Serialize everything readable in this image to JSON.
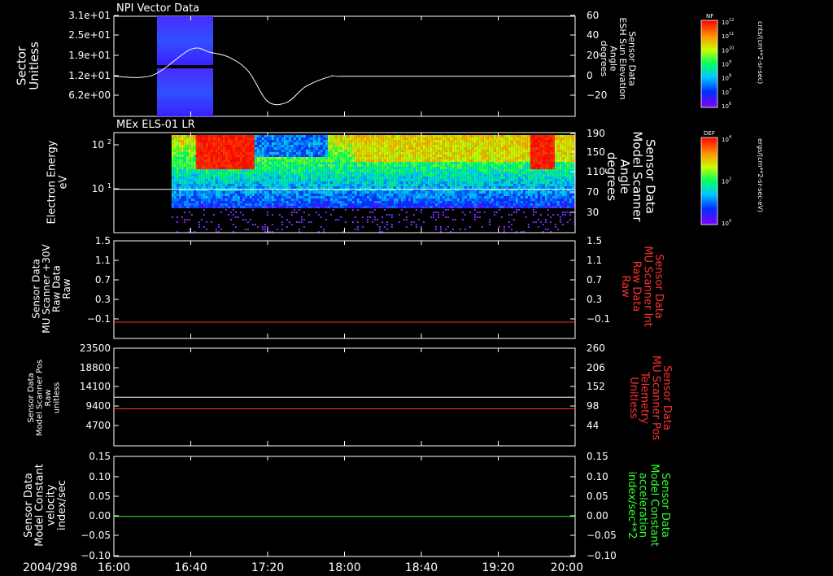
{
  "date_label": "2004/298",
  "time_ticks": [
    "16:00",
    "16:40",
    "17:20",
    "18:00",
    "18:40",
    "19:20",
    "20:00"
  ],
  "panels": [
    {
      "id": "npi",
      "title": "NPI Vector Data",
      "left_label": [
        "Sector",
        "Unitless"
      ],
      "left_ticks": [
        "3.1e+01",
        "2.5e+01",
        "1.9e+01",
        "1.2e+01",
        "6.2e+00"
      ],
      "right_label": [
        "Sensor Data",
        "ESH Sun Elevation",
        "Angle",
        "degrees"
      ],
      "right_ticks": [
        "60",
        "40",
        "20",
        "0",
        "−20"
      ],
      "right_label_color": "#ffffff"
    },
    {
      "id": "els",
      "title": "MEx ELS-01 LR",
      "left_label": [
        "Electron Energy",
        "eV"
      ],
      "left_ticks": [
        "10",
        "10"
      ],
      "left_tick_exps": [
        "2",
        "1"
      ],
      "right_label": [
        "Sensor Data",
        "Model Scanner",
        "Angle",
        "degrees"
      ],
      "right_ticks": [
        "190",
        "150",
        "110",
        "70",
        "30"
      ],
      "right_label_color": "#ffffff"
    },
    {
      "id": "mu30",
      "title": "",
      "left_label": [
        "Sensor Data",
        "MU Scanner +30V",
        "Raw Data",
        "Raw"
      ],
      "left_ticks": [
        "1.5",
        "1.1",
        "0.7",
        "0.3",
        "−0.1"
      ],
      "right_label": [
        "Sensor Data",
        "MU Scanner Int",
        "Raw Data",
        "Raw"
      ],
      "right_ticks": [
        "1.5",
        "1.1",
        "0.7",
        "0.3",
        "−0.1"
      ],
      "right_label_color": "#ff3030"
    },
    {
      "id": "pos",
      "title": "",
      "left_label": [
        "Sensor Data",
        "Model Scanner Pos",
        "Raw",
        "unitless"
      ],
      "left_ticks": [
        "23500",
        "18800",
        "14100",
        "9400",
        "4700"
      ],
      "right_label": [
        "Sensor Data",
        "MU Scanner Pos",
        "Telemetry",
        "Unitless"
      ],
      "right_ticks": [
        "260",
        "206",
        "152",
        "98",
        "44"
      ],
      "right_label_color": "#ff3030"
    },
    {
      "id": "const",
      "title": "",
      "left_label": [
        "Sensor Data",
        "Model Constant",
        "velocity",
        "index/sec"
      ],
      "left_ticks": [
        "0.15",
        "0.10",
        "0.05",
        "0.00",
        "−0.05",
        "−0.10"
      ],
      "right_label": [
        "Sensor Data",
        "Model Constant",
        "acceleration",
        "index/sec**2"
      ],
      "right_ticks": [
        "0.15",
        "0.10",
        "0.05",
        "0.00",
        "−0.05",
        "−0.10"
      ],
      "right_label_color": "#30ff30"
    }
  ],
  "colorbars": [
    {
      "name": "NF",
      "unit": "cnts/(cm**2-sr-sec)",
      "ticks": [
        "10",
        "10",
        "10",
        "10",
        "10",
        "10",
        "10"
      ],
      "tick_exps": [
        "12",
        "11",
        "10",
        "9",
        "8",
        "7",
        "6"
      ]
    },
    {
      "name": "DEF",
      "unit": "ergs/(cm**2-sr-sec-eV)",
      "ticks": [
        "10",
        "10",
        "10"
      ],
      "tick_exps": [
        "4",
        "2",
        "0"
      ]
    }
  ],
  "chart_data": [
    {
      "type": "line",
      "title": "NPI Vector Data",
      "ylabel": "Sector Unitless",
      "y2label": "Sensor Data ESH Sun Elevation Angle degrees",
      "xlim": [
        "16:00",
        "20:00"
      ],
      "y2lim": [
        -40,
        60
      ],
      "spectrogram_span": [
        "16:30",
        "17:00"
      ],
      "series": [
        {
          "color": "#ffffff",
          "x": [
            "16:00",
            "16:20",
            "16:40",
            "16:50",
            "17:00",
            "17:10",
            "17:20",
            "17:30",
            "17:40",
            "17:53",
            "18:00",
            "19:00",
            "20:00"
          ],
          "values": [
            0,
            1,
            27,
            24,
            19,
            5,
            -25,
            -26,
            -10,
            0,
            0,
            0,
            0
          ]
        }
      ]
    },
    {
      "type": "heatmap",
      "title": "MEx ELS-01 LR",
      "ylabel": "Electron Energy eV",
      "y2label": "Sensor Data Model Scanner Angle degrees",
      "xlim": [
        "16:00",
        "20:00"
      ],
      "data_span": [
        "16:30",
        "20:00"
      ],
      "y2lim": [
        10,
        190
      ],
      "series": [
        {
          "color": "#ffffff",
          "x": [
            "16:00",
            "20:00"
          ],
          "values": [
            88,
            88
          ]
        }
      ]
    },
    {
      "type": "line",
      "ylabel": "Sensor Data MU Scanner +30V Raw Data Raw",
      "y2label": "Sensor Data MU Scanner Int Raw Data Raw",
      "xlim": [
        "16:00",
        "20:00"
      ],
      "ylim": [
        -0.3,
        1.5
      ],
      "series": [
        {
          "color": "#ff3030",
          "x": [
            "16:00",
            "20:00"
          ],
          "values": [
            0.0,
            0.0
          ]
        }
      ]
    },
    {
      "type": "line",
      "ylabel": "Sensor Data Model Scanner Pos Raw unitless",
      "y2label": "Sensor Data MU Scanner Pos Telemetry Unitless",
      "xlim": [
        "16:00",
        "20:00"
      ],
      "ylim": [
        0,
        23500
      ],
      "series": [
        {
          "color": "#ffffff",
          "x": [
            "16:00",
            "20:00"
          ],
          "values": [
            11700,
            11700
          ]
        },
        {
          "color": "#ff3030",
          "x": [
            "16:00",
            "20:00"
          ],
          "values": [
            8900,
            8900
          ]
        }
      ]
    },
    {
      "type": "line",
      "ylabel": "Sensor Data Model Constant velocity index/sec",
      "y2label": "Sensor Data Model Constant acceleration index/sec**2",
      "xlim": [
        "16:00",
        "20:00"
      ],
      "ylim": [
        -0.1,
        0.15
      ],
      "series": [
        {
          "color": "#30ff30",
          "x": [
            "16:00",
            "20:00"
          ],
          "values": [
            0.0,
            0.0
          ]
        }
      ]
    }
  ]
}
